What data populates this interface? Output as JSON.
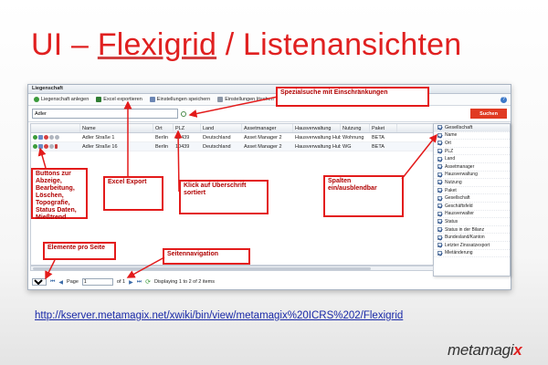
{
  "slide": {
    "title_prefix": "UI – ",
    "title_underlined": "Flexigrid",
    "title_suffix": " / Listenansichten"
  },
  "app": {
    "panel_title": "Liegenschaft",
    "toolbar": {
      "add_label": "Liegenschaft anlegen",
      "excel_label": "Excel exportieren",
      "save_label": "Einstellungen speichern",
      "delete_label": "Einstellungen löschen"
    },
    "search": {
      "value": "Adler",
      "button_label": "Suchen"
    },
    "columns": [
      "Name",
      "Ort",
      "PLZ",
      "Land",
      "Assetmanager",
      "Hausverwaltung",
      "Nutzung",
      "Paket"
    ],
    "rows": [
      [
        "Adler Straße 1",
        "Berlin",
        "10439",
        "Deutschland",
        "Asset Manager 2",
        "Hausverwaltung Hube",
        "Wohnung",
        "BETA"
      ],
      [
        "Adler Straße 16",
        "Berlin",
        "10439",
        "Deutschland",
        "Asset Manager 2",
        "Hausverwaltung Hube",
        "WG",
        "BETA"
      ]
    ],
    "column_menu": {
      "header": "Gesellschaft",
      "items": [
        "Name",
        "Ort",
        "PLZ",
        "Land",
        "Assetmanager",
        "Hausverwaltung",
        "Nutzung",
        "Paket",
        "Gesellschaft",
        "Geschäftsfeld",
        "Hausverwalter",
        "Status",
        "Status in der Bilanz",
        "Bundesland/Kanton",
        "Letzter Zinssatzexport",
        "Mietänderung"
      ]
    },
    "pager": {
      "per_page": "25",
      "page_label": "Page",
      "page_value": "1",
      "of_label": "of 1",
      "displaying": "Displaying 1 to 2 of 2 items"
    }
  },
  "annotations": {
    "spezialsuche": "Spezialsuche mit Einschränkungen",
    "buttons": "Buttons zur Abzeige, Bearbeitung, Löschen, Topografie, Status Daten, Mießtrend",
    "excel": "Excel Export",
    "klick": "Klick auf Überschrift sortiert",
    "spalten": "Spalten ein/ausblendbar",
    "elemente": "Elemente pro Seite",
    "seitennavigation": "Seitennavigation"
  },
  "link": "http://kserver.metamagix.net/xwiki/bin/view/metamagix%20ICRS%202/Flexigrid",
  "logo": {
    "main": "metamagi",
    "accent": "x"
  },
  "colors": {
    "title_red": "#e02020",
    "annotation_red": "#e31b1b",
    "search_button": "#e03a22",
    "link_blue": "#1a2aa8"
  }
}
